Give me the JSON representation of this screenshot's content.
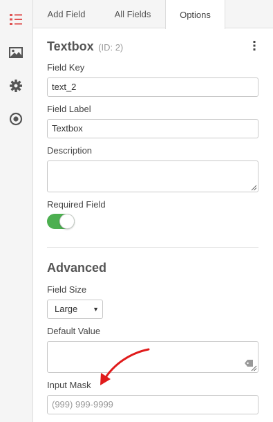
{
  "tabs": [
    {
      "label": "Add Field",
      "active": false
    },
    {
      "label": "All Fields",
      "active": false
    },
    {
      "label": "Options",
      "active": true
    }
  ],
  "rail_icons": [
    "fields-list-icon",
    "image-icon",
    "gear-icon",
    "radio-target-icon"
  ],
  "field": {
    "title": "Textbox",
    "id_text": "(ID: 2)",
    "field_key_label": "Field Key",
    "field_key_value": "text_2",
    "field_label_label": "Field Label",
    "field_label_value": "Textbox",
    "description_label": "Description",
    "description_value": "",
    "required_label": "Required Field",
    "required_on": true
  },
  "advanced": {
    "title": "Advanced",
    "field_size_label": "Field Size",
    "field_size_value": "Large",
    "default_value_label": "Default Value",
    "default_value": "",
    "input_mask_label": "Input Mask",
    "input_mask_placeholder": "(999) 999-9999"
  },
  "colors": {
    "accent_red": "#e05252",
    "toggle_green": "#4caf50",
    "arrow_red": "#e01b1b"
  }
}
